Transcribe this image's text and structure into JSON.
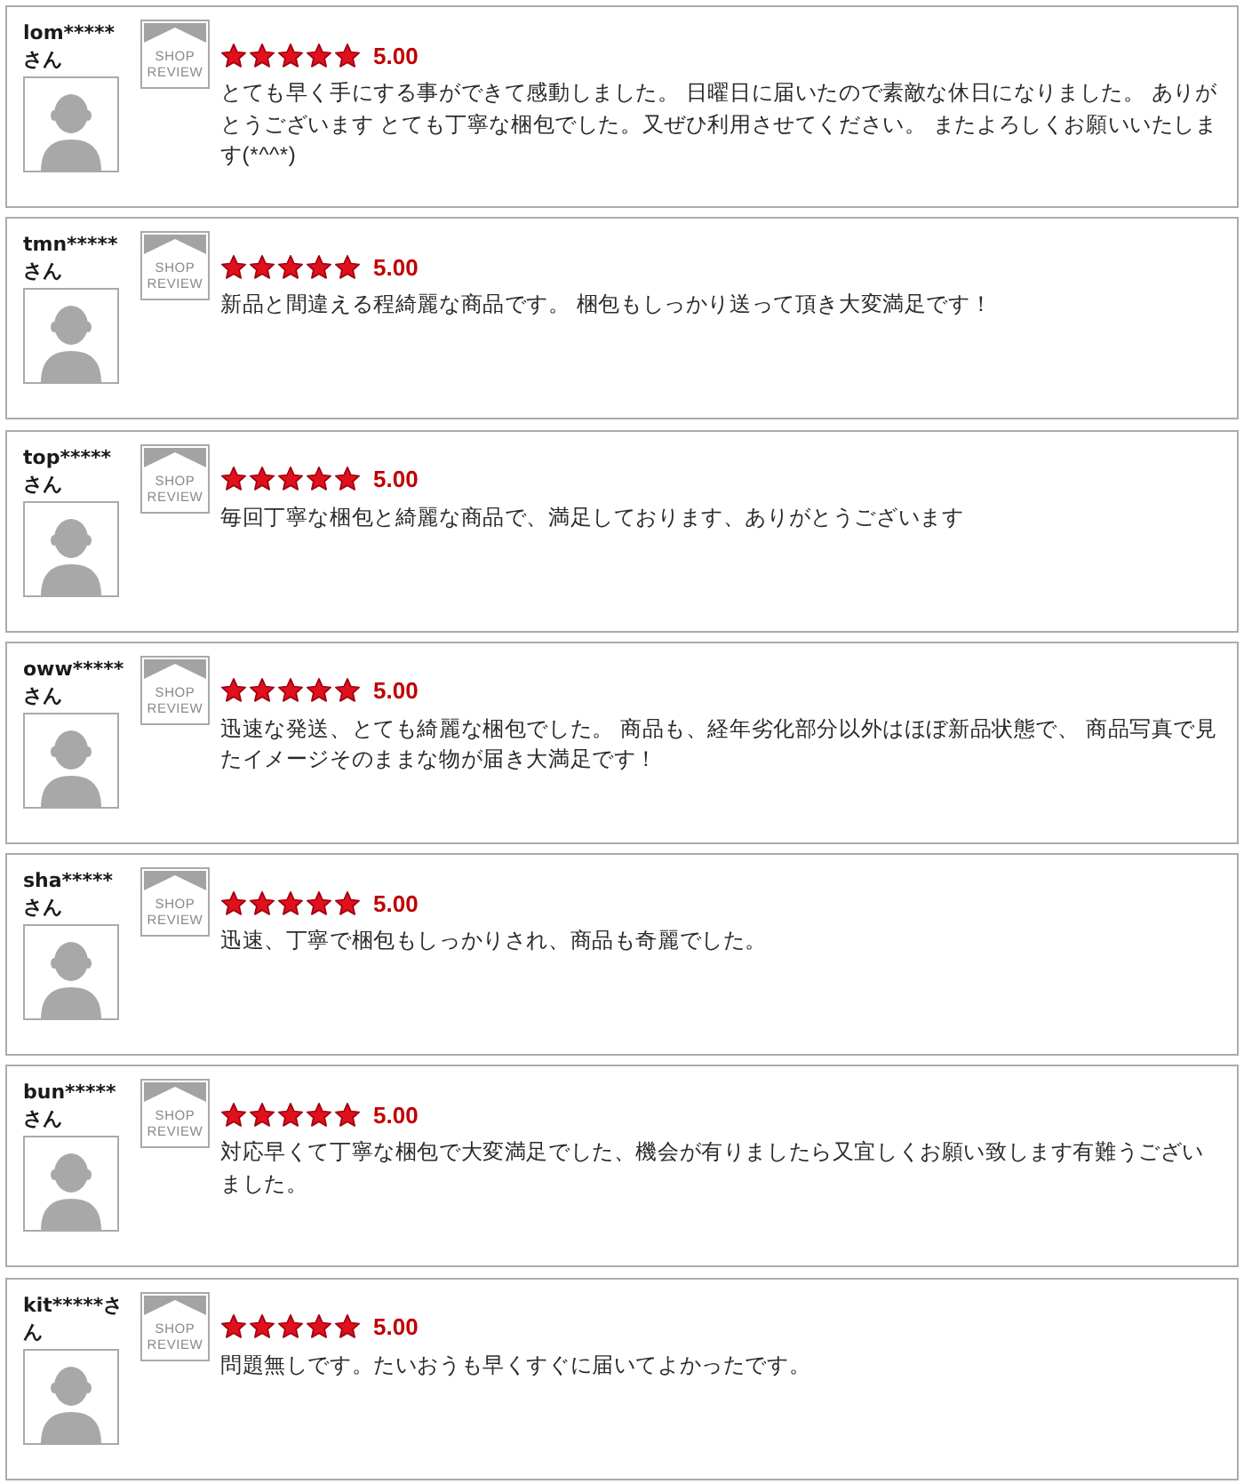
{
  "reviews": [
    {
      "user": "lom*****さん",
      "badge": "SHOP REVIEW",
      "stars": 5,
      "rating": "5.00",
      "comment": "とても早く手にする事ができて感動しました。 日曜日に届いたので素敵な休日になりました。 ありがとうございます とても丁寧な梱包でした。又ぜひ利用させてください。 またよろしくお願いいたします(*^^*)"
    },
    {
      "user": "tmn*****さん",
      "badge": "SHOP REVIEW",
      "stars": 5,
      "rating": "5.00",
      "comment": "新品と間違える程綺麗な商品です。 梱包もしっかり送って頂き大変満足です！"
    },
    {
      "user": "top*****さん",
      "badge": "SHOP REVIEW",
      "stars": 5,
      "rating": "5.00",
      "comment": "毎回丁寧な梱包と綺麗な商品で、満足しております、ありがとうございます"
    },
    {
      "user": "oww*****さん",
      "badge": "SHOP REVIEW",
      "stars": 5,
      "rating": "5.00",
      "comment": "迅速な発送、とても綺麗な梱包でした。 商品も、経年劣化部分以外はほぼ新品状態で、 商品写真で見たイメージそのままな物が届き大満足です！"
    },
    {
      "user": "sha*****さん",
      "badge": "SHOP REVIEW",
      "stars": 5,
      "rating": "5.00",
      "comment": "迅速、丁寧で梱包もしっかりされ、商品も奇麗でした。"
    },
    {
      "user": "bun*****さん",
      "badge": "SHOP REVIEW",
      "stars": 5,
      "rating": "5.00",
      "comment": "対応早くて丁寧な梱包で大変満足でした、機会が有りましたら又宜しくお願い致します有難うございました。"
    },
    {
      "user": "kit*****さん",
      "badge": "SHOP REVIEW",
      "stars": 5,
      "rating": "5.00",
      "comment": "問題無しです。たいおうも早くすぐに届いてよかったです。"
    }
  ]
}
